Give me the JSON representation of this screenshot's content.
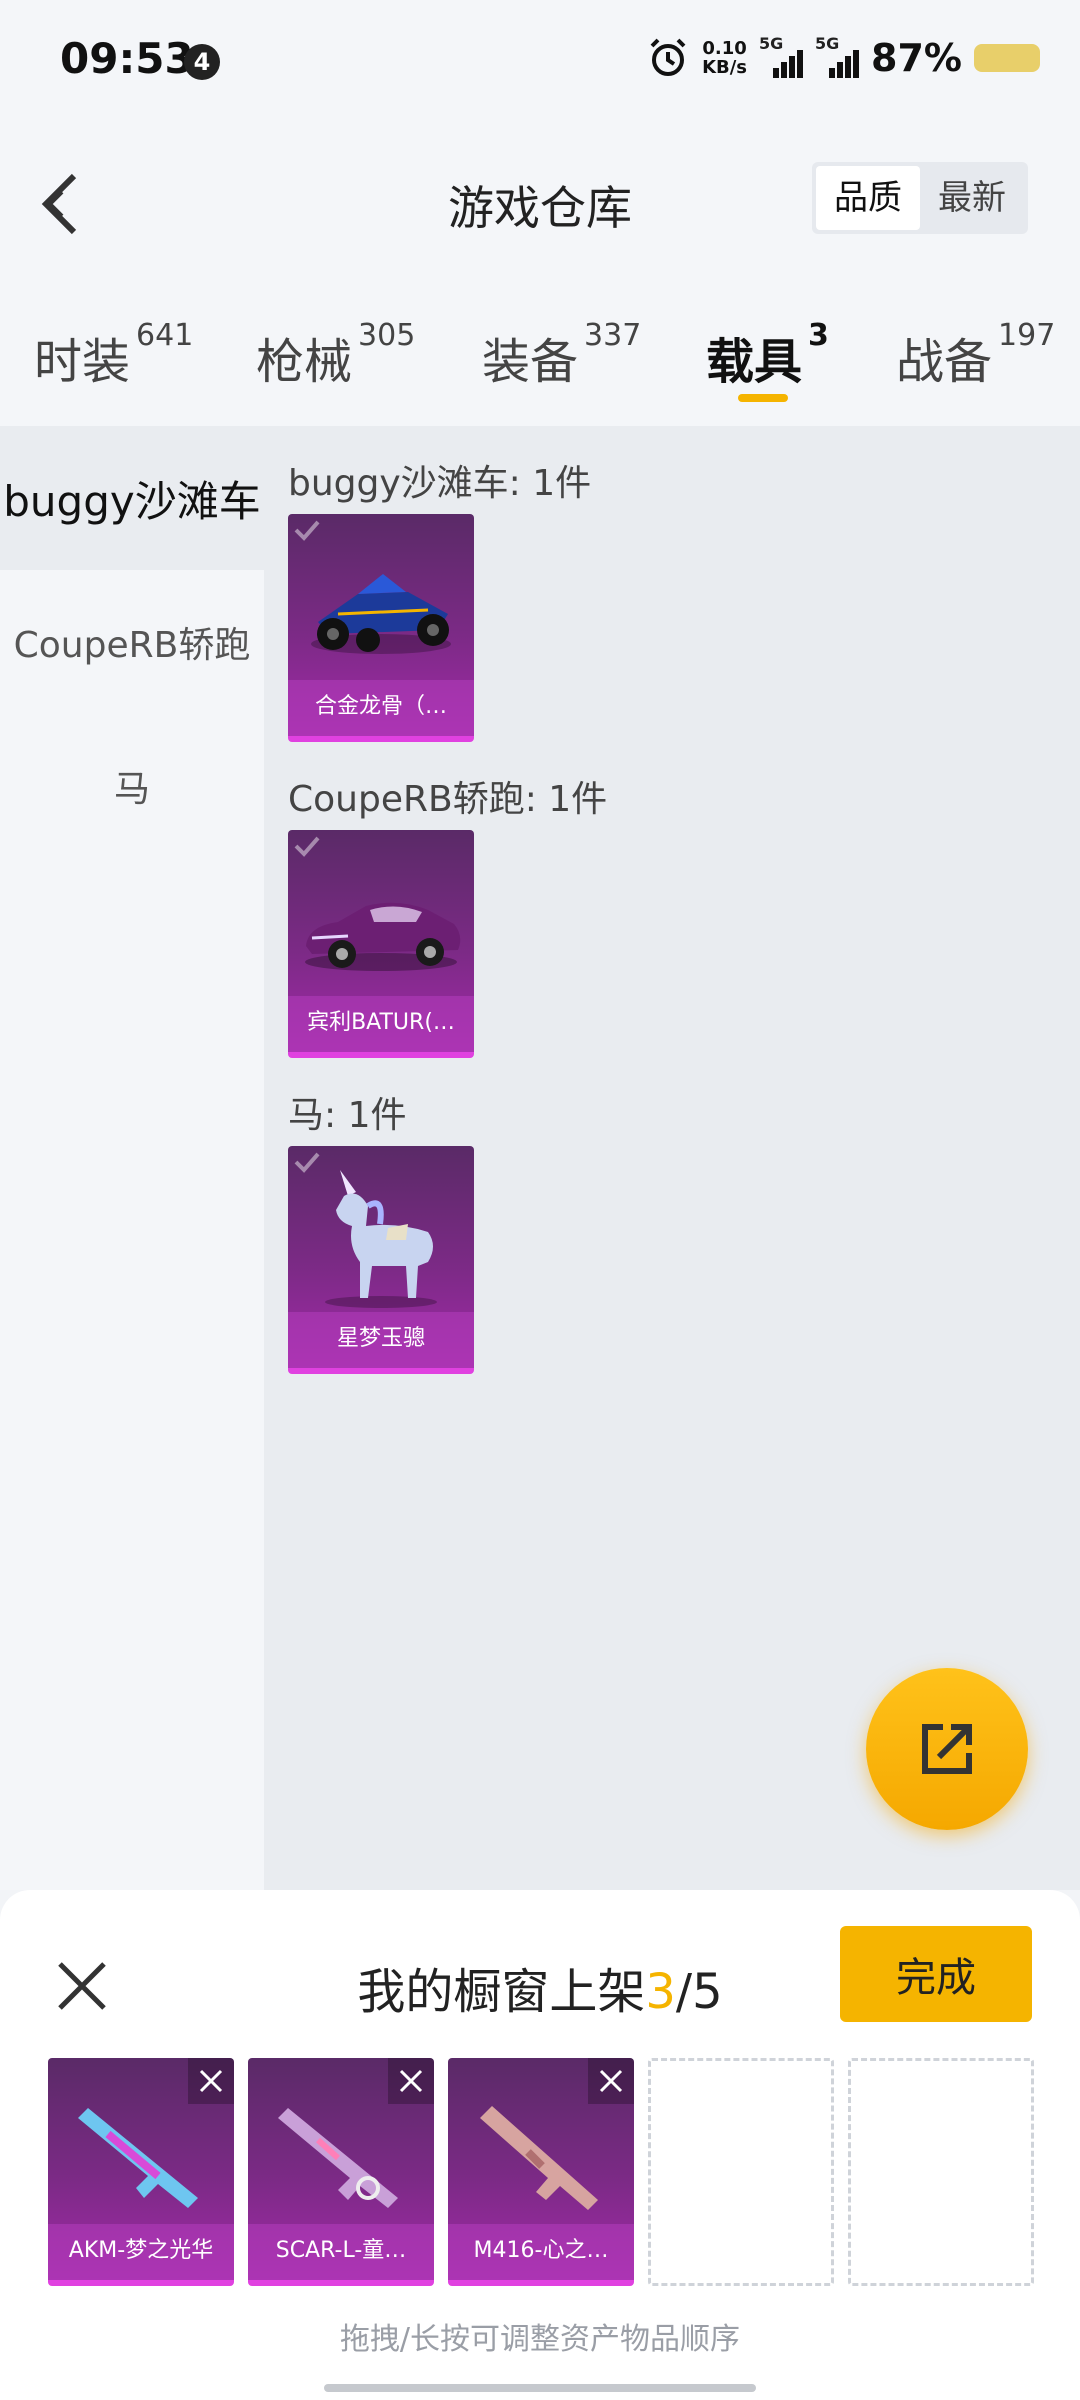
{
  "status_bar": {
    "time": "09:53",
    "notification_count": "4",
    "net_speed_value": "0.10",
    "net_speed_unit": "KB/s",
    "sim1_network": "5G",
    "sim2_network": "5G",
    "battery_percent": "87%"
  },
  "header": {
    "title": "游戏仓库",
    "sort_options": [
      "品质",
      "最新"
    ],
    "active_sort": "品质"
  },
  "tabs": [
    {
      "label": "时装",
      "count": "641"
    },
    {
      "label": "枪械",
      "count": "305"
    },
    {
      "label": "装备",
      "count": "337"
    },
    {
      "label": "载具",
      "count": "3"
    },
    {
      "label": "战备",
      "count": "197"
    }
  ],
  "active_tab": "载具",
  "sidebar": {
    "items": [
      {
        "label": "buggy沙滩车"
      },
      {
        "label": "CoupeRB轿跑"
      },
      {
        "label": "马"
      }
    ]
  },
  "groups": [
    {
      "title": "buggy沙滩车: 1件",
      "items": [
        {
          "name": "合金龙骨（…",
          "icon": "buggy-icon"
        }
      ]
    },
    {
      "title": "CoupeRB轿跑: 1件",
      "items": [
        {
          "name": "宾利BATUR(…",
          "icon": "car-icon"
        }
      ]
    },
    {
      "title": "马: 1件",
      "items": [
        {
          "name": "星梦玉骢",
          "icon": "unicorn-icon"
        }
      ]
    }
  ],
  "fab": {
    "icon": "share-icon"
  },
  "showcase": {
    "title_prefix": "我的橱窗上架",
    "current": "3",
    "separator": "/",
    "max": "5",
    "done_label": "完成",
    "slots": [
      {
        "name": "AKM-梦之光华",
        "icon": "rifle-icon"
      },
      {
        "name": "SCAR-L-童…",
        "icon": "rifle-icon"
      },
      {
        "name": "M416-心之…",
        "icon": "rifle-icon"
      }
    ],
    "hint": "拖拽/长按可调整资产物品顺序"
  },
  "colors": {
    "accent": "#f5b400",
    "card_purple": "#7c2a86",
    "card_edge": "#e041e0"
  }
}
